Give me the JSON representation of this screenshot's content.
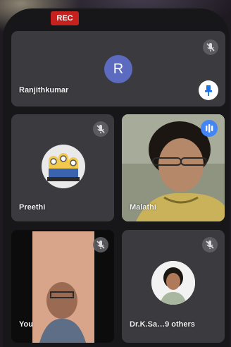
{
  "recording_badge": "REC",
  "participants": {
    "main": {
      "name": "Ranjithkumar",
      "initial": "R"
    },
    "tile2": {
      "name": "Preethi"
    },
    "tile3": {
      "name": "Malathi"
    },
    "tile4": {
      "name": "You"
    },
    "tile5": {
      "name": "Dr.K.Sa…9 others"
    }
  },
  "icons": {
    "mic_off": "mic-off-icon",
    "pin": "pin-icon",
    "speaking": "speaking-indicator-icon"
  },
  "colors": {
    "rec_red": "#c5221f",
    "avatar_blue": "#5c6bc0",
    "speaking_blue": "#4285f4",
    "tile_gray": "#3a3a3f"
  }
}
